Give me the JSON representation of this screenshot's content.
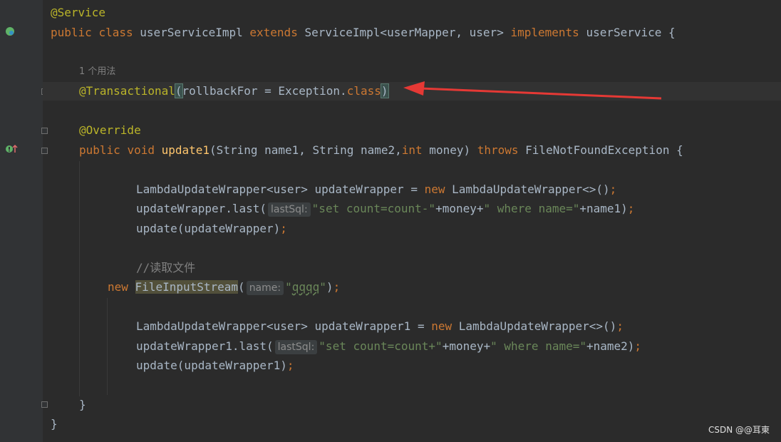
{
  "editor": {
    "usage_hint": "1 个用法",
    "lines": {
      "l1_annotation": "@Service",
      "l2_public": "public",
      "l2_class": "class",
      "l2_name": "userServiceImpl",
      "l2_extends": "extends",
      "l2_super": "ServiceImpl<userMapper, user>",
      "l2_implements": "implements",
      "l2_iface": "userService {",
      "l5_annotation": "@Transactional",
      "l5_paren_open": "(",
      "l5_args": "rollbackFor = Exception.",
      "l5_class_kw": "class",
      "l5_paren_close": ")",
      "l7_override": "@Override",
      "l8_public": "public",
      "l8_void": "void",
      "l8_method": "update1",
      "l8_params_a": "(String name1, String name2,",
      "l8_int": "int",
      "l8_params_b": " money) ",
      "l8_throws": "throws",
      "l8_exception": " FileNotFoundException {",
      "l10_a": "LambdaUpdateWrapper<user> updateWrapper = ",
      "l10_new": "new",
      "l10_b": " LambdaUpdateWrapper<>()",
      "l10_semi": ";",
      "l11_a": "updateWrapper.last(",
      "l11_hint": "lastSql:",
      "l11_str1": "\"set count=count-\"",
      "l11_mid": "+money+",
      "l11_str2": "\" where name=\"",
      "l11_end": "+name1)",
      "l11_semi": ";",
      "l12_a": "update(updateWrapper)",
      "l12_semi": ";",
      "l14_comment": "//读取文件",
      "l15_new": "new",
      "l15_cls": "FileInputStream",
      "l15_paren": "(",
      "l15_hint": "name:",
      "l15_str_q": "\"",
      "l15_str_val": "qqqq",
      "l15_str_q2": "\"",
      "l15_end": ")",
      "l15_semi": ";",
      "l17_a": "LambdaUpdateWrapper<user> updateWrapper1 = ",
      "l17_new": "new",
      "l17_b": " LambdaUpdateWrapper<>()",
      "l17_semi": ";",
      "l18_a": "updateWrapper1.last(",
      "l18_hint": "lastSql:",
      "l18_str1": "\"set count=count+\"",
      "l18_mid": "+money+",
      "l18_str2": "\" where name=\"",
      "l18_end": "+name2)",
      "l18_semi": ";",
      "l19_a": "update(updateWrapper1)",
      "l19_semi": ";",
      "l21_brace": "}",
      "l22_brace": "}"
    }
  },
  "gutter_icons": [
    "spring-bean-icon",
    "implements-method-icon"
  ],
  "watermark": "CSDN @@耳東",
  "colors": {
    "background": "#2b2b2b",
    "keyword": "#cc7832",
    "annotation": "#bbb529",
    "method": "#ffc66d",
    "string": "#6a8759",
    "comment": "#808080",
    "text": "#a9b7c6",
    "arrow": "#e53935"
  }
}
